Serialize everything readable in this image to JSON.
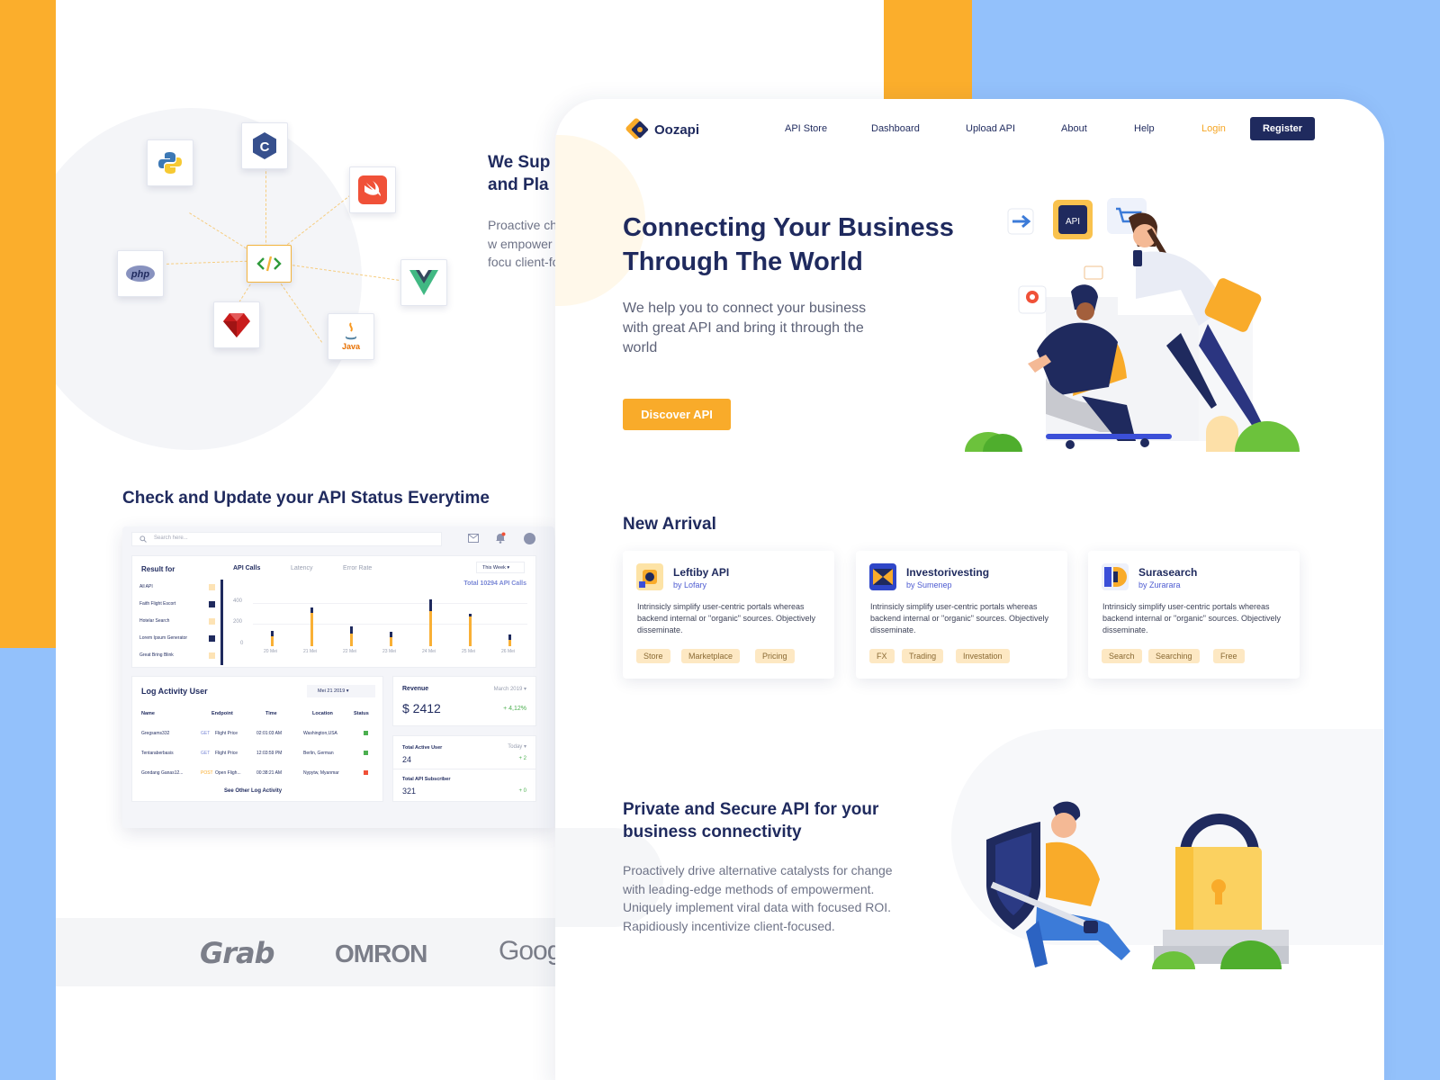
{
  "back_page": {
    "support_title": "We Sup\nand Pla",
    "support_text": "Proactive change w empower with focu client-foc",
    "languages": [
      {
        "name": "python-icon",
        "glyph": "🐍"
      },
      {
        "name": "c-sharp-icon",
        "glyph": "C"
      },
      {
        "name": "swift-icon",
        "glyph": "✈"
      },
      {
        "name": "php-icon",
        "glyph": "php"
      },
      {
        "name": "code-icon",
        "glyph": "</>"
      },
      {
        "name": "vue-icon",
        "glyph": "V"
      },
      {
        "name": "ruby-icon",
        "glyph": "◆"
      },
      {
        "name": "java-icon",
        "glyph": "Java"
      }
    ],
    "status_title": "Check and Update your API Status Everytime",
    "dashboard": {
      "search_placeholder": "Search here...",
      "result_for": "Result for",
      "filters": [
        "All API",
        "Faith Flight Escort",
        "Hotelar Search",
        "Lorem Ipsum Generator",
        "Great Bring Blink"
      ],
      "tabs": [
        "API Calls",
        "Latency",
        "Error Rate"
      ],
      "period": "This Week",
      "total_calls": "Total 10294 API Calls",
      "y_ticks": [
        "400",
        "200",
        "0"
      ],
      "x_ticks": [
        "20 Mei",
        "21 Mei",
        "22 Mei",
        "23 Mei",
        "24 Mei",
        "25 Mei",
        "26 Mei"
      ],
      "log_title": "Log Activity User",
      "log_date": "Mei 21 2019",
      "log_headers": [
        "Name",
        "Endpoint",
        "Time",
        "Location",
        "Status"
      ],
      "log_rows": [
        {
          "name": "Gregsams332",
          "method": "GET",
          "endpoint": "Flight Price",
          "time": "02:01:03 AM",
          "location": "Washington,USA"
        },
        {
          "name": "Tentaraberbasis",
          "method": "GET",
          "endpoint": "Flight Price",
          "time": "12:03:59 PM",
          "location": "Berlin, German"
        },
        {
          "name": "Gondang Ganas12...",
          "method": "POST",
          "endpoint": "Open Fligh...",
          "time": "00:38:21 AM",
          "location": "Nypytw, Myanmar"
        }
      ],
      "see_other": "See Other Log Activity",
      "revenue_label": "Revenue",
      "revenue_period": "March 2019",
      "revenue_value": "$ 2412",
      "revenue_change": "+ 4,12%",
      "active_user_label": "Total Active User",
      "active_user_period": "Today",
      "active_user_value": "24",
      "active_user_change": "+ 2",
      "subscriber_label": "Total API Subscriber",
      "subscriber_value": "321",
      "subscriber_change": "+ 0"
    },
    "logos": [
      "Grab",
      "OMRON",
      "Goog"
    ]
  },
  "front": {
    "brand": "Oozapi",
    "nav": [
      "API Store",
      "Dashboard",
      "Upload API",
      "About",
      "Help"
    ],
    "login": "Login",
    "register": "Register",
    "hero_title": "Connecting Your Business Through The World",
    "hero_sub": "We help you to connect your business with great API and bring it through the world",
    "discover": "Discover API",
    "api_badge": "API",
    "new_arrival": "New Arrival",
    "cards": [
      {
        "name": "Leftiby API",
        "by": "by Lofary",
        "desc": "Intrinsicly simplify user-centric portals whereas backend internal or \"organic\" sources. Objectively disseminate.",
        "tags": [
          "Store",
          "Marketplace",
          "Pricing"
        ]
      },
      {
        "name": "Investorivesting",
        "by": "by Sumenep",
        "desc": "Intrinsicly simplify user-centric portals whereas backend internal or \"organic\" sources. Objectively disseminate.",
        "tags": [
          "FX",
          "Trading",
          "Investation"
        ]
      },
      {
        "name": "Surasearch",
        "by": "by Zurarara",
        "desc": "Intrinsicly simplify user-centric portals whereas backend internal or \"organic\" sources. Objectively disseminate.",
        "tags": [
          "Search",
          "Searching",
          "Free"
        ]
      }
    ],
    "secure_title": "Private and Secure API for your business connectivity",
    "secure_text": "Proactively drive alternative catalysts for change with leading-edge methods of empowerment. Uniquely implement viral data with focused ROI. Rapidiously incentivize client-focused."
  },
  "colors": {
    "navy": "#1f2a5e",
    "orange": "#f9ab2a",
    "blue_bg": "#93c1fb",
    "tag_bg": "#fde8c3"
  }
}
